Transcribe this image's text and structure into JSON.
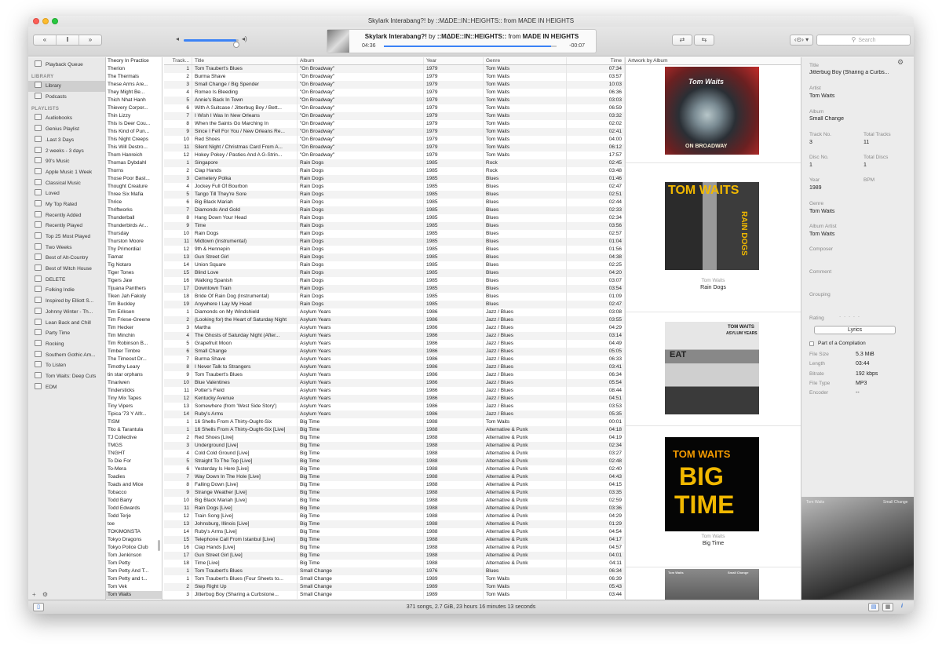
{
  "window": {
    "title": "Skylark Interabang?! by ::MΔDE::IN::HEIGHTS:: from MADE IN HEIGHTS"
  },
  "toolbar": {
    "prev": "«",
    "pause": "‖",
    "next": "»",
    "volume_low_icon": "◂",
    "volume_high_icon": "◂)",
    "volume_level": 0.95,
    "now_playing": {
      "song": "Skylark Interabang?!",
      "by": " by ",
      "artist": "::MΔDE::IN::HEIGHTS::",
      "from": " from ",
      "album": "MADE IN HEIGHTS",
      "elapsed": "04:36",
      "remaining": "-00:07",
      "progress": 0.97
    },
    "shuffle": "⇄",
    "repeat": "⇆",
    "airplay": "‹⊙› ▾",
    "search_placeholder": "Search"
  },
  "sidebar": {
    "playback_queue": "Playback Queue",
    "library_header": "LIBRARY",
    "library": [
      {
        "label": "Library",
        "selected": true
      },
      {
        "label": "Podcasts"
      }
    ],
    "playlists_header": "PLAYLISTS",
    "playlists": [
      "Audiobooks",
      "Genius Playlist",
      ".Last 3 Days",
      "2 weeks - 3 days",
      "90's Music",
      "Apple Music 1 Week",
      "Classical Music",
      "Loved",
      "My Top Rated",
      "Recently Added",
      "Recently Played",
      "Top 25 Most Played",
      "Two Weeks",
      "Best of Alt-Country",
      "Best of Witch House",
      "DELETE",
      "Folking Indie",
      "Inspired by Elliott S...",
      "Johnny Winter - Th...",
      "Lean Back and Chill",
      "Party Time",
      "Rocking",
      "Southern Gothic Am...",
      "To Listen",
      "Tom Waits: Deep Cuts",
      "EDM"
    ],
    "footer_add": "+",
    "footer_gear": "⚙"
  },
  "artists": [
    "Theory In Practice",
    "Therion",
    "The Thermals",
    "These Arms Are...",
    "They Might Be...",
    "Thich Nhat Hanh",
    "Thievery Corpor...",
    "Thin Lizzy",
    "This Is Deer Cou...",
    "This Kind of Pun...",
    "This Night Creeps",
    "This Will Destro...",
    "Thom Hanreich",
    "Thomas Dybdahl",
    "Thorns",
    "Those Poor Bast...",
    "Thought Creature",
    "Three Six Mafia",
    "Thrice",
    "Thriftworks",
    "Thunderball",
    "Thunderbirds Ar...",
    "Thursday",
    "Thurston Moore",
    "Thy Primordial",
    "Tiamat",
    "Tig Notaro",
    "Tiger Tones",
    "Tigers Jaw",
    "Tijuana Panthers",
    "Tiken Jah Fakoly",
    "Tim Buckley",
    "Tim Eriksen",
    "Tim Friese-Greene",
    "Tim Hecker",
    "Tim Minchin",
    "Tim Robinson B...",
    "Timber Timbre",
    "The Timeout Dr...",
    "Timothy Leary",
    "tin star orphans",
    "Tinariwen",
    "Tindersticks",
    "Tiny Mix Tapes",
    "Tiny Vipers",
    "Tipica '73 Y Alfr...",
    "TISM",
    "Tito & Tarantula",
    "TJ Collective",
    "TMGS",
    "TNGHT",
    "To Die For",
    "To-Mera",
    "Toadies",
    "Toads and Mice",
    "Tobacco",
    "Todd Barry",
    "Todd Edwards",
    "Todd Terje",
    "toe",
    "TOKiMONSTA",
    "Tokyo Dragons",
    "Tokyo Police Club",
    "Tom Jenkinson",
    "Tom Petty",
    "Tom Petty And T...",
    "Tom Petty and t...",
    "Tom Vek",
    "Tom Waits"
  ],
  "columns": {
    "track": "Track...",
    "title": "Title",
    "album": "Album",
    "year": "Year",
    "genre": "Genre",
    "time": "Time",
    "artwork": "Artwork by Album"
  },
  "tracks": [
    [
      "1",
      "Tom Traubert's Blues",
      "\"On Broadway\"",
      "1979",
      "Tom Waits",
      "07:34"
    ],
    [
      "2",
      "Burma Shave",
      "\"On Broadway\"",
      "1979",
      "Tom Waits",
      "03:57"
    ],
    [
      "3",
      "Small Change / Big Spender",
      "\"On Broadway\"",
      "1979",
      "Tom Waits",
      "10:03"
    ],
    [
      "4",
      "Romeo Is Bleeding",
      "\"On Broadway\"",
      "1979",
      "Tom Waits",
      "06:36"
    ],
    [
      "5",
      "Annie's Back In Town",
      "\"On Broadway\"",
      "1979",
      "Tom Waits",
      "03:03"
    ],
    [
      "6",
      "With A Suitcase / Jitterbug Boy / Bett...",
      "\"On Broadway\"",
      "1979",
      "Tom Waits",
      "06:59"
    ],
    [
      "7",
      "I Wish I Was In New Orleans",
      "\"On Broadway\"",
      "1979",
      "Tom Waits",
      "03:32"
    ],
    [
      "8",
      "When the Saints Go Marching In",
      "\"On Broadway\"",
      "1979",
      "Tom Waits",
      "02:02"
    ],
    [
      "9",
      "Since I Fell For You / New Orleans Re...",
      "\"On Broadway\"",
      "1979",
      "Tom Waits",
      "02:41"
    ],
    [
      "10",
      "Red Shoes",
      "\"On Broadway\"",
      "1979",
      "Tom Waits",
      "04:00"
    ],
    [
      "11",
      "Silent Night / Christmas Card From A...",
      "\"On Broadway\"",
      "1979",
      "Tom Waits",
      "06:12"
    ],
    [
      "12",
      "Hokey Pokey / Pasties And A G-Strin...",
      "\"On Broadway\"",
      "1979",
      "Tom Waits",
      "17:57"
    ],
    [
      "1",
      "Singapore",
      "Rain Dogs",
      "1985",
      "Rock",
      "02:45"
    ],
    [
      "2",
      "Clap Hands",
      "Rain Dogs",
      "1985",
      "Rock",
      "03:48"
    ],
    [
      "3",
      "Cemetery Polka",
      "Rain Dogs",
      "1985",
      "Blues",
      "01:46"
    ],
    [
      "4",
      "Jockey Full Of Bourbon",
      "Rain Dogs",
      "1985",
      "Blues",
      "02:47"
    ],
    [
      "5",
      "Tango Till They're Sore",
      "Rain Dogs",
      "1985",
      "Blues",
      "02:51"
    ],
    [
      "6",
      "Big Black Mariah",
      "Rain Dogs",
      "1985",
      "Blues",
      "02:44"
    ],
    [
      "7",
      "Diamonds And Gold",
      "Rain Dogs",
      "1985",
      "Blues",
      "02:33"
    ],
    [
      "8",
      "Hang Down Your Head",
      "Rain Dogs",
      "1985",
      "Blues",
      "02:34"
    ],
    [
      "9",
      "Time",
      "Rain Dogs",
      "1985",
      "Blues",
      "03:56"
    ],
    [
      "10",
      "Rain Dogs",
      "Rain Dogs",
      "1985",
      "Blues",
      "02:57"
    ],
    [
      "11",
      "Midtown (Instrumental)",
      "Rain Dogs",
      "1985",
      "Blues",
      "01:04"
    ],
    [
      "12",
      "9th & Hennepin",
      "Rain Dogs",
      "1985",
      "Blues",
      "01:56"
    ],
    [
      "13",
      "Gun Street Girl",
      "Rain Dogs",
      "1985",
      "Blues",
      "04:38"
    ],
    [
      "14",
      "Union Square",
      "Rain Dogs",
      "1985",
      "Blues",
      "02:25"
    ],
    [
      "15",
      "Blind Love",
      "Rain Dogs",
      "1985",
      "Blues",
      "04:20"
    ],
    [
      "16",
      "Walking Spanish",
      "Rain Dogs",
      "1985",
      "Blues",
      "03:07"
    ],
    [
      "17",
      "Downtown Train",
      "Rain Dogs",
      "1985",
      "Blues",
      "03:54"
    ],
    [
      "18",
      "Bride Of Rain Dog (Instrumental)",
      "Rain Dogs",
      "1985",
      "Blues",
      "01:09"
    ],
    [
      "19",
      "Anywhere I Lay My Head",
      "Rain Dogs",
      "1985",
      "Blues",
      "02:47"
    ],
    [
      "1",
      "Diamonds on My Windshield",
      "Asylum Years",
      "1986",
      "Jazz / Blues",
      "03:08"
    ],
    [
      "2",
      "(Looking for) the Heart of Saturday Night",
      "Asylum Years",
      "1986",
      "Jazz / Blues",
      "03:55"
    ],
    [
      "3",
      "Martha",
      "Asylum Years",
      "1986",
      "Jazz / Blues",
      "04:29"
    ],
    [
      "4",
      "The Ghosts of Saturday Night (After...",
      "Asylum Years",
      "1986",
      "Jazz / Blues",
      "03:14"
    ],
    [
      "5",
      "Grapefruit Moon",
      "Asylum Years",
      "1986",
      "Jazz / Blues",
      "04:49"
    ],
    [
      "6",
      "Small Change",
      "Asylum Years",
      "1986",
      "Jazz / Blues",
      "05:05"
    ],
    [
      "7",
      "Burma Shave",
      "Asylum Years",
      "1986",
      "Jazz / Blues",
      "06:33"
    ],
    [
      "8",
      "I Never Talk to Strangers",
      "Asylum Years",
      "1986",
      "Jazz / Blues",
      "03:41"
    ],
    [
      "9",
      "Tom Traubert's Blues",
      "Asylum Years",
      "1986",
      "Jazz / Blues",
      "06:34"
    ],
    [
      "10",
      "Blue Valentines",
      "Asylum Years",
      "1986",
      "Jazz / Blues",
      "05:54"
    ],
    [
      "11",
      "Potter's Field",
      "Asylum Years",
      "1986",
      "Jazz / Blues",
      "08:44"
    ],
    [
      "12",
      "Kentucky Avenue",
      "Asylum Years",
      "1986",
      "Jazz / Blues",
      "04:51"
    ],
    [
      "13",
      "Somewhere (from 'West Side Story')",
      "Asylum Years",
      "1986",
      "Jazz / Blues",
      "03:53"
    ],
    [
      "14",
      "Ruby's Arms",
      "Asylum Years",
      "1986",
      "Jazz / Blues",
      "05:35"
    ],
    [
      "1",
      "16 Shells From A Thirty-Ought-Six",
      "Big Time",
      "1988",
      "Tom Waits",
      "00:01"
    ],
    [
      "1",
      "16 Shells From A Thirty-Ought-Six [Live]",
      "Big Time",
      "1988",
      "Alternative & Punk",
      "04:18"
    ],
    [
      "2",
      "Red Shoes [Live]",
      "Big Time",
      "1988",
      "Alternative & Punk",
      "04:19"
    ],
    [
      "3",
      "Underground [Live]",
      "Big Time",
      "1988",
      "Alternative & Punk",
      "02:34"
    ],
    [
      "4",
      "Cold Cold Ground [Live]",
      "Big Time",
      "1988",
      "Alternative & Punk",
      "03:27"
    ],
    [
      "5",
      "Straight To The Top [Live]",
      "Big Time",
      "1988",
      "Alternative & Punk",
      "02:48"
    ],
    [
      "6",
      "Yesterday Is Here [Live]",
      "Big Time",
      "1988",
      "Alternative & Punk",
      "02:40"
    ],
    [
      "7",
      "Way Down In The Hole [Live]",
      "Big Time",
      "1988",
      "Alternative & Punk",
      "04:43"
    ],
    [
      "8",
      "Falling Down [Live]",
      "Big Time",
      "1988",
      "Alternative & Punk",
      "04:15"
    ],
    [
      "9",
      "Strange Weather [Live]",
      "Big Time",
      "1988",
      "Alternative & Punk",
      "03:35"
    ],
    [
      "10",
      "Big Black Mariah [Live]",
      "Big Time",
      "1988",
      "Alternative & Punk",
      "02:59"
    ],
    [
      "11",
      "Rain Dogs [Live]",
      "Big Time",
      "1988",
      "Alternative & Punk",
      "03:36"
    ],
    [
      "12",
      "Train Song [Live]",
      "Big Time",
      "1988",
      "Alternative & Punk",
      "04:29"
    ],
    [
      "13",
      "Johnsburg, Illinois [Live]",
      "Big Time",
      "1988",
      "Alternative & Punk",
      "01:29"
    ],
    [
      "14",
      "Ruby's Arms [Live]",
      "Big Time",
      "1988",
      "Alternative & Punk",
      "04:54"
    ],
    [
      "15",
      "Telephone Call From Istanbul [Live]",
      "Big Time",
      "1988",
      "Alternative & Punk",
      "04:17"
    ],
    [
      "16",
      "Clap Hands [Live]",
      "Big Time",
      "1988",
      "Alternative & Punk",
      "04:57"
    ],
    [
      "17",
      "Gun Street Girl [Live]",
      "Big Time",
      "1988",
      "Alternative & Punk",
      "04:01"
    ],
    [
      "18",
      "Time [Live]",
      "Big Time",
      "1988",
      "Alternative & Punk",
      "04:11"
    ],
    [
      "1",
      "Tom Traubert's Blues",
      "Small Change",
      "1976",
      "Blues",
      "06:34"
    ],
    [
      "1",
      "Tom Traubert's Blues (Four Sheets to...",
      "Small Change",
      "1989",
      "Tom Waits",
      "06:39"
    ],
    [
      "2",
      "Step Right Up",
      "Small Change",
      "1989",
      "Tom Waits",
      "05:43"
    ],
    [
      "3",
      "Jitterbug Boy (Sharing a Curbstone...",
      "Small Change",
      "1989",
      "Tom Waits",
      "03:44"
    ]
  ],
  "selected_track_index": 70,
  "artwork": [
    {
      "cover_text": "Tom Waits",
      "cover_sub": "ON BROADWAY"
    },
    {
      "cover_text": "TOM WAITS",
      "cover_sub": "RAIN DOGS",
      "artist": "Tom Waits",
      "album": "Rain Dogs"
    },
    {
      "cover_text": "TOM WAITS",
      "cover_sub": "ASYLUM YEARS",
      "cover_extra": "EAT"
    },
    {
      "cover_text": "TOM WAITS",
      "cover_big1": "BIG",
      "cover_big2": "TIME",
      "artist": "Tom Waits",
      "album": "Big Time"
    },
    {
      "cover_text": "Tom Waits",
      "cover_sub": "Small Change"
    }
  ],
  "inspector": {
    "gear": "⚙",
    "title_label": "Title",
    "title": "Jitterbug Boy (Sharing a Curbs...",
    "artist_label": "Artist",
    "artist": "Tom Waits",
    "album_label": "Album",
    "album": "Small Change",
    "track_no_label": "Track No.",
    "track_no": "3",
    "total_tracks_label": "Total Tracks",
    "total_tracks": "11",
    "disc_no_label": "Disc No.",
    "disc_no": "1",
    "total_discs_label": "Total Discs",
    "total_discs": "1",
    "year_label": "Year",
    "year": "1989",
    "bpm_label": "BPM",
    "genre_label": "Genre",
    "genre": "Tom Waits",
    "album_artist_label": "Album Artist",
    "album_artist": "Tom Waits",
    "composer_label": "Composer",
    "comment_label": "Comment",
    "grouping_label": "Grouping",
    "rating_label": "Rating",
    "rating_dots": "· · · · ·",
    "lyrics_button": "Lyrics",
    "compilation_label": "Part of a Compilation",
    "file_size_label": "File Size",
    "file_size": "5.3 MiB",
    "length_label": "Length",
    "length": "03:44",
    "bitrate_label": "Bitrate",
    "bitrate": "192 kbps",
    "file_type_label": "File Type",
    "file_type": "MP3",
    "encoder_label": "Encoder",
    "encoder": "--",
    "art_left": "Tom Waits",
    "art_right": "Small Change"
  },
  "status": {
    "summary": "371 songs,  2.7 GiB,  23 hours 16 minutes 13 seconds"
  },
  "colors": {
    "accent": "#2f6fd6",
    "cover_yellow": "#f1b800",
    "cover_orange": "#f39a00"
  }
}
